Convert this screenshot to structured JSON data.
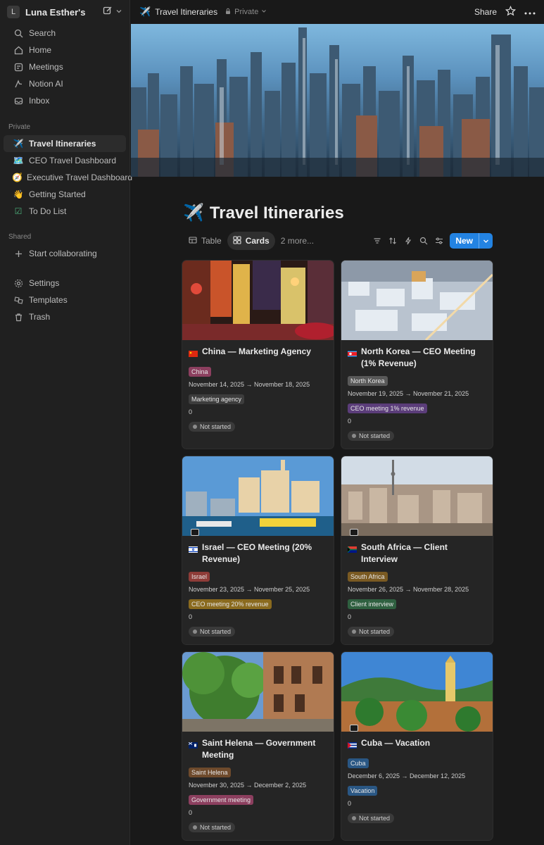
{
  "sidebar": {
    "workspace": {
      "avatar": "L",
      "name": "Luna Esther's"
    },
    "top_items": [
      {
        "label": "Search",
        "icon": "search-icon"
      },
      {
        "label": "Home",
        "icon": "home-icon"
      },
      {
        "label": "Meetings",
        "icon": "meetings-icon"
      },
      {
        "label": "Notion AI",
        "icon": "notion-ai-icon"
      },
      {
        "label": "Inbox",
        "icon": "inbox-icon"
      }
    ],
    "private_label": "Private",
    "private_items": [
      {
        "label": "Travel Itineraries",
        "icon": "airplane-icon",
        "emoji": "✈️",
        "active": true
      },
      {
        "label": "CEO Travel Dashboard",
        "icon": "map-icon",
        "emoji": "🗺️"
      },
      {
        "label": "Executive Travel Dashboard",
        "icon": "compass-icon",
        "emoji": "🧭"
      },
      {
        "label": "Getting Started",
        "icon": "wave-icon",
        "emoji": "👋"
      },
      {
        "label": "To Do List",
        "icon": "checklist-icon",
        "emoji": "☑"
      }
    ],
    "shared_label": "Shared",
    "shared_items": [
      {
        "label": "Start collaborating",
        "icon": "plus-icon"
      }
    ],
    "bottom_items": [
      {
        "label": "Settings",
        "icon": "gear-icon"
      },
      {
        "label": "Templates",
        "icon": "templates-icon"
      },
      {
        "label": "Trash",
        "icon": "trash-icon"
      }
    ]
  },
  "topbar": {
    "page_emoji": "✈️",
    "page_title": "Travel Itineraries",
    "privacy": "Private",
    "share": "Share"
  },
  "page": {
    "emoji": "✈️",
    "title": "Travel Itineraries",
    "views": [
      {
        "label": "Table",
        "active": false
      },
      {
        "label": "Cards",
        "active": true
      }
    ],
    "more_views": "2 more...",
    "new_button": "New"
  },
  "cards": [
    {
      "flag": "🇨🇳",
      "title": "China — Marketing Agency",
      "country": "China",
      "country_color": "#8c3f5f",
      "dates": "November 14, 2025 → November 18, 2025",
      "purpose": "Marketing agency",
      "purpose_color": "#3d3d3d",
      "number": "0",
      "status": "Not started"
    },
    {
      "flag": "🇰🇵",
      "title": "North Korea — CEO Meeting (1% Revenue)",
      "country": "North Korea",
      "country_color": "#595959",
      "dates": "November 19, 2025 → November 21, 2025",
      "purpose": "CEO meeting 1% revenue",
      "purpose_color": "#5b3d7a",
      "number": "0",
      "status": "Not started"
    },
    {
      "flag": "🇮🇱",
      "title": "Israel — CEO Meeting (20% Revenue)",
      "country": "Israel",
      "country_color": "#8e3c38",
      "dates": "November 23, 2025 → November 25, 2025",
      "purpose": "CEO meeting 20% revenue",
      "purpose_color": "#8a6a1e",
      "number": "0",
      "status": "Not started"
    },
    {
      "flag": "🇿🇦",
      "title": "South Africa — Client Interview",
      "country": "South Africa",
      "country_color": "#7a5a22",
      "dates": "November 26, 2025 → November 28, 2025",
      "purpose": "Client interview",
      "purpose_color": "#2f6040",
      "number": "0",
      "status": "Not started"
    },
    {
      "flag": "🇸🇭",
      "title": "Saint Helena — Government Meeting",
      "country": "Saint Helena",
      "country_color": "#6e4a2c",
      "dates": "November 30, 2025 → December 2, 2025",
      "purpose": "Government meeting",
      "purpose_color": "#8c3f5f",
      "number": "0",
      "status": "Not started"
    },
    {
      "flag": "🇨🇺",
      "title": "Cuba — Vacation",
      "country": "Cuba",
      "country_color": "#2a5784",
      "dates": "December 6, 2025 → December 12, 2025",
      "purpose": "Vacation",
      "purpose_color": "#2a5784",
      "number": "0",
      "status": "Not started"
    }
  ],
  "colors": {
    "accent": "#2383e2",
    "background": "#191919",
    "sidebar": "#202020",
    "card": "#252525"
  }
}
